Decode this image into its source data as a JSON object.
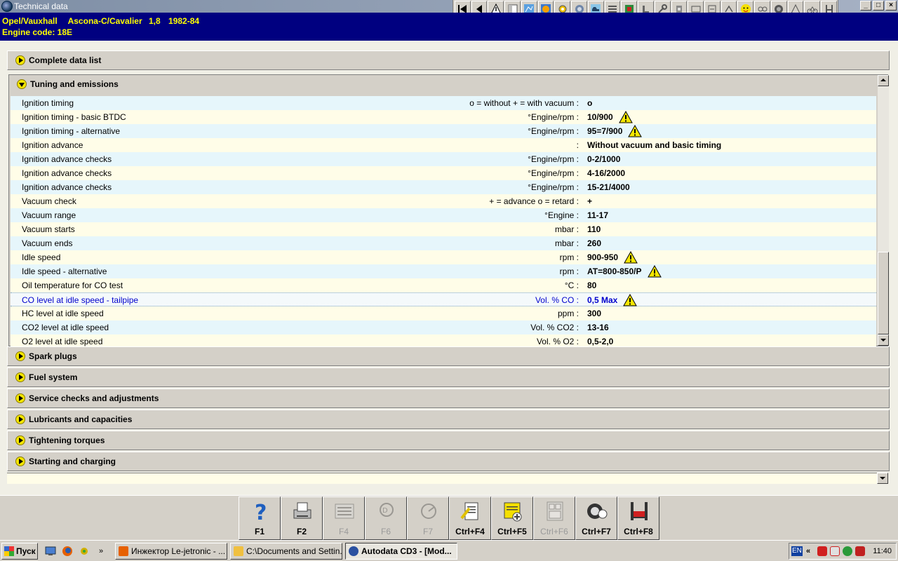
{
  "window": {
    "title": "Technical data",
    "controls": [
      "_",
      "□",
      "×"
    ]
  },
  "toolbar": {
    "icons": [
      "first-icon",
      "previous-icon",
      "warning-icon",
      "document-icon",
      "diagram-icon",
      "timing-icon",
      "gear-icon",
      "lamp-icon",
      "vehicle-icon",
      "tools-icon",
      "battery-icon",
      "seat-icon",
      "wrench-icon",
      "cylinder-icon",
      "window-icon",
      "emission-icon",
      "aircon-icon",
      "smiley-icon",
      "belt-icon",
      "wheel-icon",
      "triangle-icon",
      "bike-icon",
      "lift-icon"
    ]
  },
  "vehicle": {
    "make": "Opel/Vauxhall",
    "model": "Ascona-C/Cavalier",
    "engine_size": "1,8",
    "years": "1982-84",
    "engine_code_label": "Engine code: 18E"
  },
  "sections": {
    "complete": "Complete data list",
    "tuning": "Tuning and emissions",
    "spark": "Spark plugs",
    "fuel": "Fuel system",
    "service": "Service checks and adjustments",
    "lubricants": "Lubricants and capacities",
    "torques": "Tightening torques",
    "starting": "Starting and charging"
  },
  "rows": [
    {
      "label": "Ignition timing",
      "unit": "o = without  + = with vacuum :",
      "value": "o"
    },
    {
      "label": "Ignition timing - basic  BTDC",
      "unit": "°Engine/rpm :",
      "value": "10/900",
      "warning": true
    },
    {
      "label": "Ignition timing - alternative",
      "unit": "°Engine/rpm :",
      "value": "95=7/900",
      "warning": true
    },
    {
      "label": "Ignition advance",
      "unit": ":",
      "value": "Without vacuum and basic timing"
    },
    {
      "label": "Ignition advance checks",
      "unit": "°Engine/rpm :",
      "value": "0-2/1000"
    },
    {
      "label": "Ignition advance checks",
      "unit": "°Engine/rpm :",
      "value": "4-16/2000"
    },
    {
      "label": "Ignition advance checks",
      "unit": "°Engine/rpm :",
      "value": "15-21/4000"
    },
    {
      "label": "Vacuum check",
      "unit": "+ = advance  o = retard :",
      "value": "+"
    },
    {
      "label": "Vacuum range",
      "unit": "°Engine :",
      "value": "11-17"
    },
    {
      "label": "Vacuum starts",
      "unit": "mbar :",
      "value": "110"
    },
    {
      "label": "Vacuum ends",
      "unit": "mbar :",
      "value": "260"
    },
    {
      "label": "Idle speed",
      "unit": "rpm :",
      "value": "900-950",
      "warning": true
    },
    {
      "label": "Idle speed - alternative",
      "unit": "rpm :",
      "value": "AT=800-850/P",
      "warning": true
    },
    {
      "label": "Oil temperature for CO test",
      "unit": "°C :",
      "value": "80"
    },
    {
      "label": "CO level at idle speed - tailpipe",
      "unit": "Vol. % CO :",
      "value": "0,5 Max",
      "warning": true,
      "selected": true
    },
    {
      "label": "HC level at idle speed",
      "unit": "ppm :",
      "value": "300"
    },
    {
      "label": "CO2 level at idle speed",
      "unit": "Vol. % CO2 :",
      "value": "13-16"
    },
    {
      "label": "O2 level at idle speed",
      "unit": "Vol. % O2 :",
      "value": "0,5-2,0"
    }
  ],
  "fkeys": [
    "F1",
    "F2",
    "F4",
    "F6",
    "F7",
    "Ctrl+F4",
    "Ctrl+F5",
    "Ctrl+F6",
    "Ctrl+F7",
    "Ctrl+F8"
  ],
  "taskbar": {
    "start": "Пуск",
    "quick_more": "»",
    "tasks": [
      "Инжектор Le-jetronic - ...",
      "C:\\Documents and Settin...",
      "Autodata CD3 - [Mod..."
    ],
    "lang": "EN",
    "tray_more": "«",
    "clock": "11:40"
  }
}
